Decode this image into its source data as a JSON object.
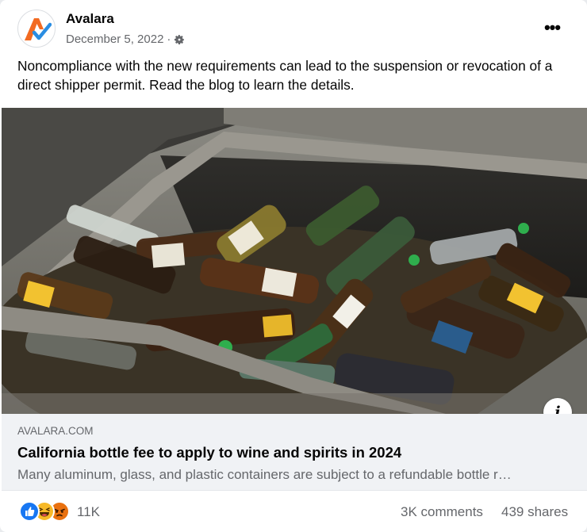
{
  "post": {
    "author": "Avalara",
    "date": "December 5, 2022",
    "separator": "·",
    "audience_icon": "gear-icon",
    "more_icon_text": "•••",
    "text": "Noncompliance with the new requirements can lead to the suspension or revocation of a direct shipper permit. Read the blog to learn the details."
  },
  "link": {
    "domain": "AVALARA.COM",
    "title": "California bottle fee to apply to wine and spirits in 2024",
    "description": "Many aluminum, glass, and plastic containers are subject to a refundable bottle r…",
    "info_icon_text": "i"
  },
  "engagement": {
    "reactions": [
      "like",
      "haha",
      "angry"
    ],
    "reaction_count": "11K",
    "comments": "3K comments",
    "shares": "439 shares"
  },
  "colors": {
    "brand_orange": "#f26a21",
    "brand_blue": "#2a8de2",
    "like_blue": "#1877f2",
    "secondary_text": "#65676b"
  }
}
